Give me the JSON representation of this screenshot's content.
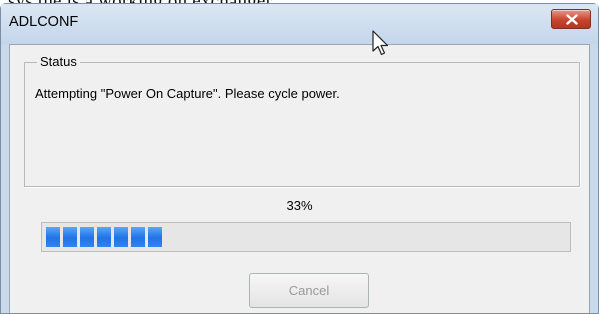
{
  "background_text": "sys the is a working on exchanger",
  "window": {
    "title": "ADLCONF"
  },
  "status_group": {
    "label": "Status",
    "message": "Attempting \"Power On Capture\".  Please cycle power."
  },
  "progress": {
    "percent_label": "33%",
    "value": 0.33,
    "block_count": 7
  },
  "buttons": {
    "cancel_label": "Cancel",
    "cancel_enabled": false
  },
  "colors": {
    "progress_fill": "#2478e8",
    "close_button": "#c8452e",
    "window_frame": "#c9d9ea"
  },
  "icons": {
    "close": "close-icon",
    "cursor": "mouse-pointer-icon"
  }
}
